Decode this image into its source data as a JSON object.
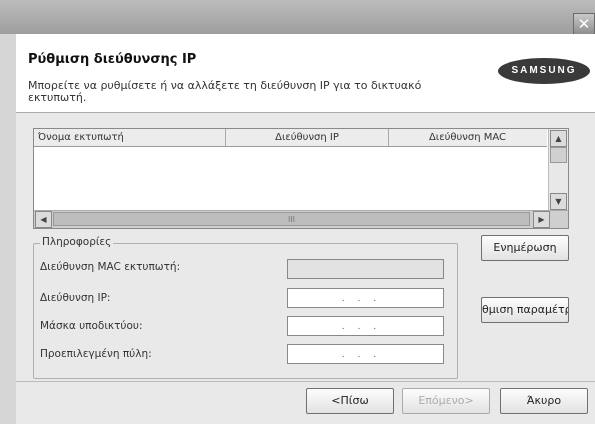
{
  "window": {
    "close_glyph": "✕"
  },
  "header": {
    "title": "Ρύθμιση διεύθυνσης IP",
    "description": "Μπορείτε να ρυθμίσετε ή να αλλάξετε τη διεύθυνση IP για το δικτυακό εκτυπωτή.",
    "logo_text": "SAMSUNG"
  },
  "printer_list": {
    "columns": [
      "Όνομα εκτυπωτή",
      "Διεύθυνση IP",
      "Διεύθυνση MAC"
    ],
    "rows": [],
    "scroll_up_glyph": "▲",
    "scroll_down_glyph": "▼",
    "scroll_left_glyph": "◀",
    "scroll_right_glyph": "▶",
    "hthumb_grip": "III"
  },
  "info": {
    "group_label": "Πληροφορίες",
    "mac_label": "Διεύθυνση MAC εκτυπωτή:",
    "mac_value": "",
    "ip_label": "Διεύθυνση IP:",
    "ip_value": "...",
    "subnet_label": "Μάσκα υποδικτύου:",
    "subnet_value": "...",
    "gateway_label": "Προεπιλεγμένη πύλη:",
    "gateway_value": "..."
  },
  "buttons": {
    "refresh": "Ενημέρωση",
    "configure": "θμιση παραμέτρ",
    "back": "<Πίσω",
    "next": "Επόμενο>",
    "cancel": "Άκυρο"
  }
}
